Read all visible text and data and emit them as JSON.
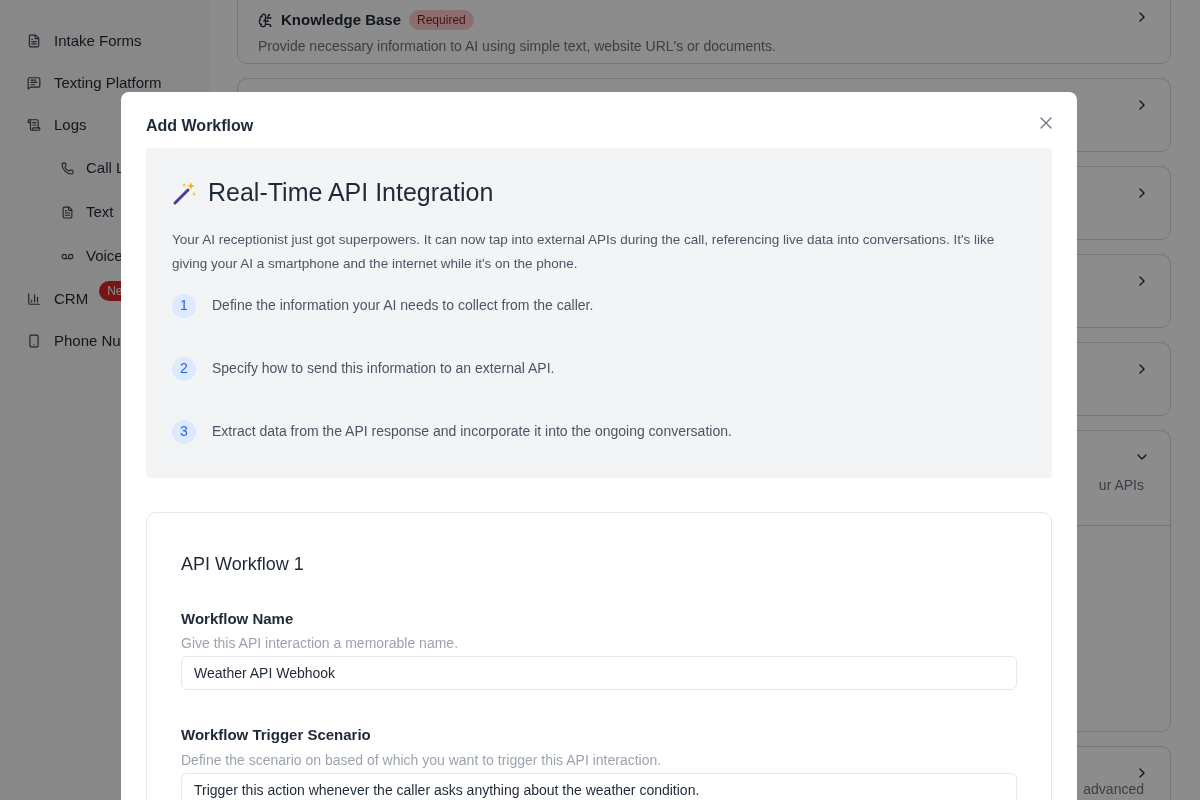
{
  "sidebar": {
    "items": [
      {
        "label": "Intake Forms"
      },
      {
        "label": "Texting Platform"
      },
      {
        "label": "Logs",
        "children": [
          {
            "label": "Call L"
          },
          {
            "label": "Text"
          },
          {
            "label": "Voice"
          }
        ]
      },
      {
        "label": "CRM",
        "badge": "Ne"
      },
      {
        "label": "Phone Nu"
      }
    ]
  },
  "cards": [
    {
      "title": "Knowledge Base",
      "badge": "Required",
      "description": "Provide necessary information to AI using simple text, website URL's or documents.",
      "expanded": false
    },
    {
      "expanded": false
    },
    {
      "expanded": false
    },
    {
      "expanded": false
    },
    {
      "expanded": false
    },
    {
      "description": "ur APIs",
      "expanded": true
    },
    {
      "description": "advanced",
      "expanded": false
    }
  ],
  "modal": {
    "title": "Add Workflow",
    "intro": {
      "title": "Real-Time API Integration",
      "text": "Your AI receptionist just got superpowers. It can now tap into external APIs during the call, referencing live data into conversations. It's like giving your AI a smartphone and the internet while it's on the phone.",
      "steps": [
        {
          "number": "1",
          "text": "Define the information your AI needs to collect from the caller."
        },
        {
          "number": "2",
          "text": "Specify how to send this information to an external API."
        },
        {
          "number": "3",
          "text": "Extract data from the API response and incorporate it into the ongoing conversation."
        }
      ]
    },
    "workflow": {
      "title": "API Workflow 1",
      "fields": [
        {
          "label": "Workflow Name",
          "hint": "Give this API interaction a memorable name.",
          "value": "Weather API Webhook"
        },
        {
          "label": "Workflow Trigger Scenario",
          "hint": "Define the scenario on based of which you want to trigger this API interaction.",
          "value": "Trigger this action whenever the caller asks anything about the weather condition."
        }
      ]
    }
  }
}
